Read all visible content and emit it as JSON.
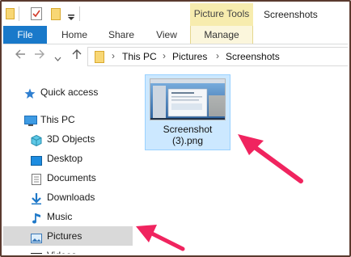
{
  "window": {
    "title": "Screenshots"
  },
  "ribbon": {
    "contextual_group": "Picture Tools",
    "tabs": [
      {
        "label": "File"
      },
      {
        "label": "Home"
      },
      {
        "label": "Share"
      },
      {
        "label": "View"
      },
      {
        "label": "Manage"
      }
    ]
  },
  "address_bar": {
    "breadcrumbs": [
      "This PC",
      "Pictures",
      "Screenshots"
    ]
  },
  "sidebar": {
    "items": [
      {
        "label": "Quick access",
        "icon": "star-icon"
      },
      {
        "label": "This PC",
        "icon": "monitor-icon"
      },
      {
        "label": "3D Objects",
        "icon": "cube-icon"
      },
      {
        "label": "Desktop",
        "icon": "desktop-icon"
      },
      {
        "label": "Documents",
        "icon": "document-icon"
      },
      {
        "label": "Downloads",
        "icon": "download-icon"
      },
      {
        "label": "Music",
        "icon": "music-note-icon"
      },
      {
        "label": "Pictures",
        "icon": "picture-icon",
        "selected": true
      },
      {
        "label": "Videos",
        "icon": "film-icon"
      }
    ]
  },
  "files": [
    {
      "name": "Screenshot (3).png",
      "line1": "Screenshot",
      "line2": "(3).png",
      "selected": true
    }
  ],
  "colors": {
    "file_tab": "#1979ca",
    "contextual_tab": "#f7ecae",
    "selection": "#cce8ff",
    "annotation_arrow": "#f0245f"
  }
}
